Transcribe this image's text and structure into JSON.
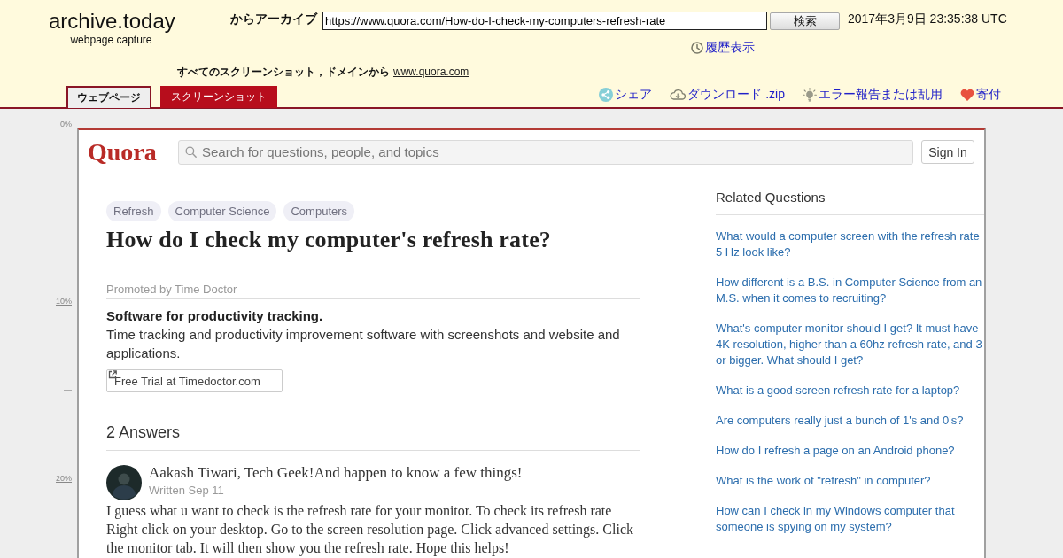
{
  "header": {
    "logo": "archive.today",
    "tagline": "webpage capture",
    "archive_label": "からアーカイブ",
    "url_field": {
      "value": "https://www.quora.com/How-do-I-check-my-computers-refresh-rate"
    },
    "search_button": "検索",
    "capture_time": "2017年3月9日 23:35:38 UTC",
    "history_link": "履歴表示",
    "domain_text": "すべてのスクリーンショット，ドメインから",
    "domain_link": "www.quora.com"
  },
  "tabs": [
    {
      "label": "ウェブページ",
      "selected": true
    },
    {
      "label": "スクリーンショット",
      "selected": false
    }
  ],
  "actions": [
    {
      "kind": "share",
      "label": "シェア"
    },
    {
      "kind": "download",
      "label": "ダウンロード .zip"
    },
    {
      "kind": "report",
      "label": "エラー報告または乱用"
    },
    {
      "kind": "donate",
      "label": "寄付"
    }
  ],
  "scale": [
    {
      "kind": "label",
      "text": "0%"
    },
    {
      "kind": "tick",
      "text": "—"
    },
    {
      "kind": "label",
      "text": "10%"
    },
    {
      "kind": "tick",
      "text": "—"
    },
    {
      "kind": "label",
      "text": "20%"
    }
  ],
  "page": {
    "logo": "Quora",
    "search": {
      "placeholder": "Search for questions, people, and topics"
    },
    "sign_in": "Sign In",
    "topics": [
      "Refresh",
      "Computer Science",
      "Computers"
    ],
    "question": "How do I check my computer's refresh rate?",
    "promo": {
      "sponsor": "Promoted by Time Doctor",
      "headline": "Software for productivity tracking.",
      "body": "Time tracking and productivity improvement software with screenshots and website and applications.",
      "cta": "Free Trial at Timedoctor.com"
    },
    "answers_count": "2 Answers",
    "answers": [
      {
        "author": "Aakash Tiwari, Tech Geek!And happen to know a few things!",
        "date": "Written Sep 11",
        "body": "I guess what u want to check is the refresh rate for your monitor. To check its refresh rate Right click on your desktop. Go to the screen resolution page. Click advanced settings. Click the monitor tab. It will then show you the refresh rate. Hope this helps!"
      }
    ],
    "related": {
      "title": "Related Questions",
      "items": [
        {
          "lines": [
            "What would a computer screen with the refresh rate",
            "5 Hz look like?"
          ]
        },
        {
          "lines": [
            "How different is a B.S. in Computer Science from an",
            "M.S. when it comes to recruiting?"
          ]
        },
        {
          "lines": [
            "What's computer monitor should I get? It must have",
            "4K resolution, higher than a 60hz refresh rate, and 3",
            "or bigger. What should I get?"
          ]
        },
        {
          "lines": [
            "What is a good screen refresh rate for a laptop?"
          ]
        },
        {
          "lines": [
            "Are computers really just a bunch of 1's and 0's?"
          ]
        },
        {
          "lines": [
            "How do I refresh a page on an Android phone?"
          ]
        },
        {
          "lines": [
            "What is the work of \"refresh\" in computer?"
          ]
        },
        {
          "lines": [
            "How can I check in my Windows computer that",
            "someone is spying on my system?"
          ]
        }
      ]
    }
  }
}
